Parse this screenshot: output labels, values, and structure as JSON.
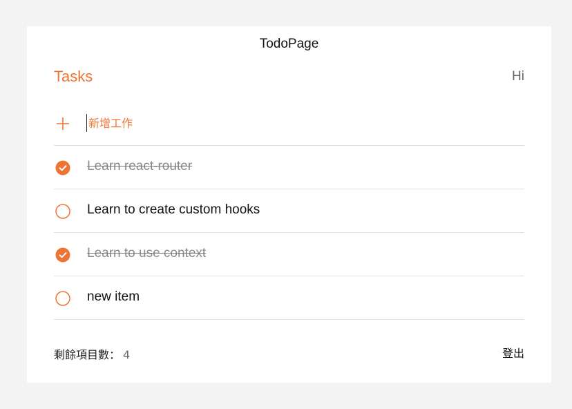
{
  "header": {
    "app_title": "TodoPage",
    "tasks_heading": "Tasks",
    "greeting": "Hi"
  },
  "add_task": {
    "placeholder": "新增工作",
    "value": "",
    "icon": "plus-icon"
  },
  "todos": [
    {
      "text": "Learn react-router",
      "done": true
    },
    {
      "text": "Learn to create custom hooks",
      "done": false
    },
    {
      "text": "Learn to use context",
      "done": true
    },
    {
      "text": "new item",
      "done": false
    }
  ],
  "footer": {
    "remaining_label": "剩餘項目數：",
    "remaining_count": "4",
    "logout_label": "登出"
  },
  "colors": {
    "accent": "#ee7434",
    "background": "#f3f3f3",
    "card": "#ffffff"
  }
}
